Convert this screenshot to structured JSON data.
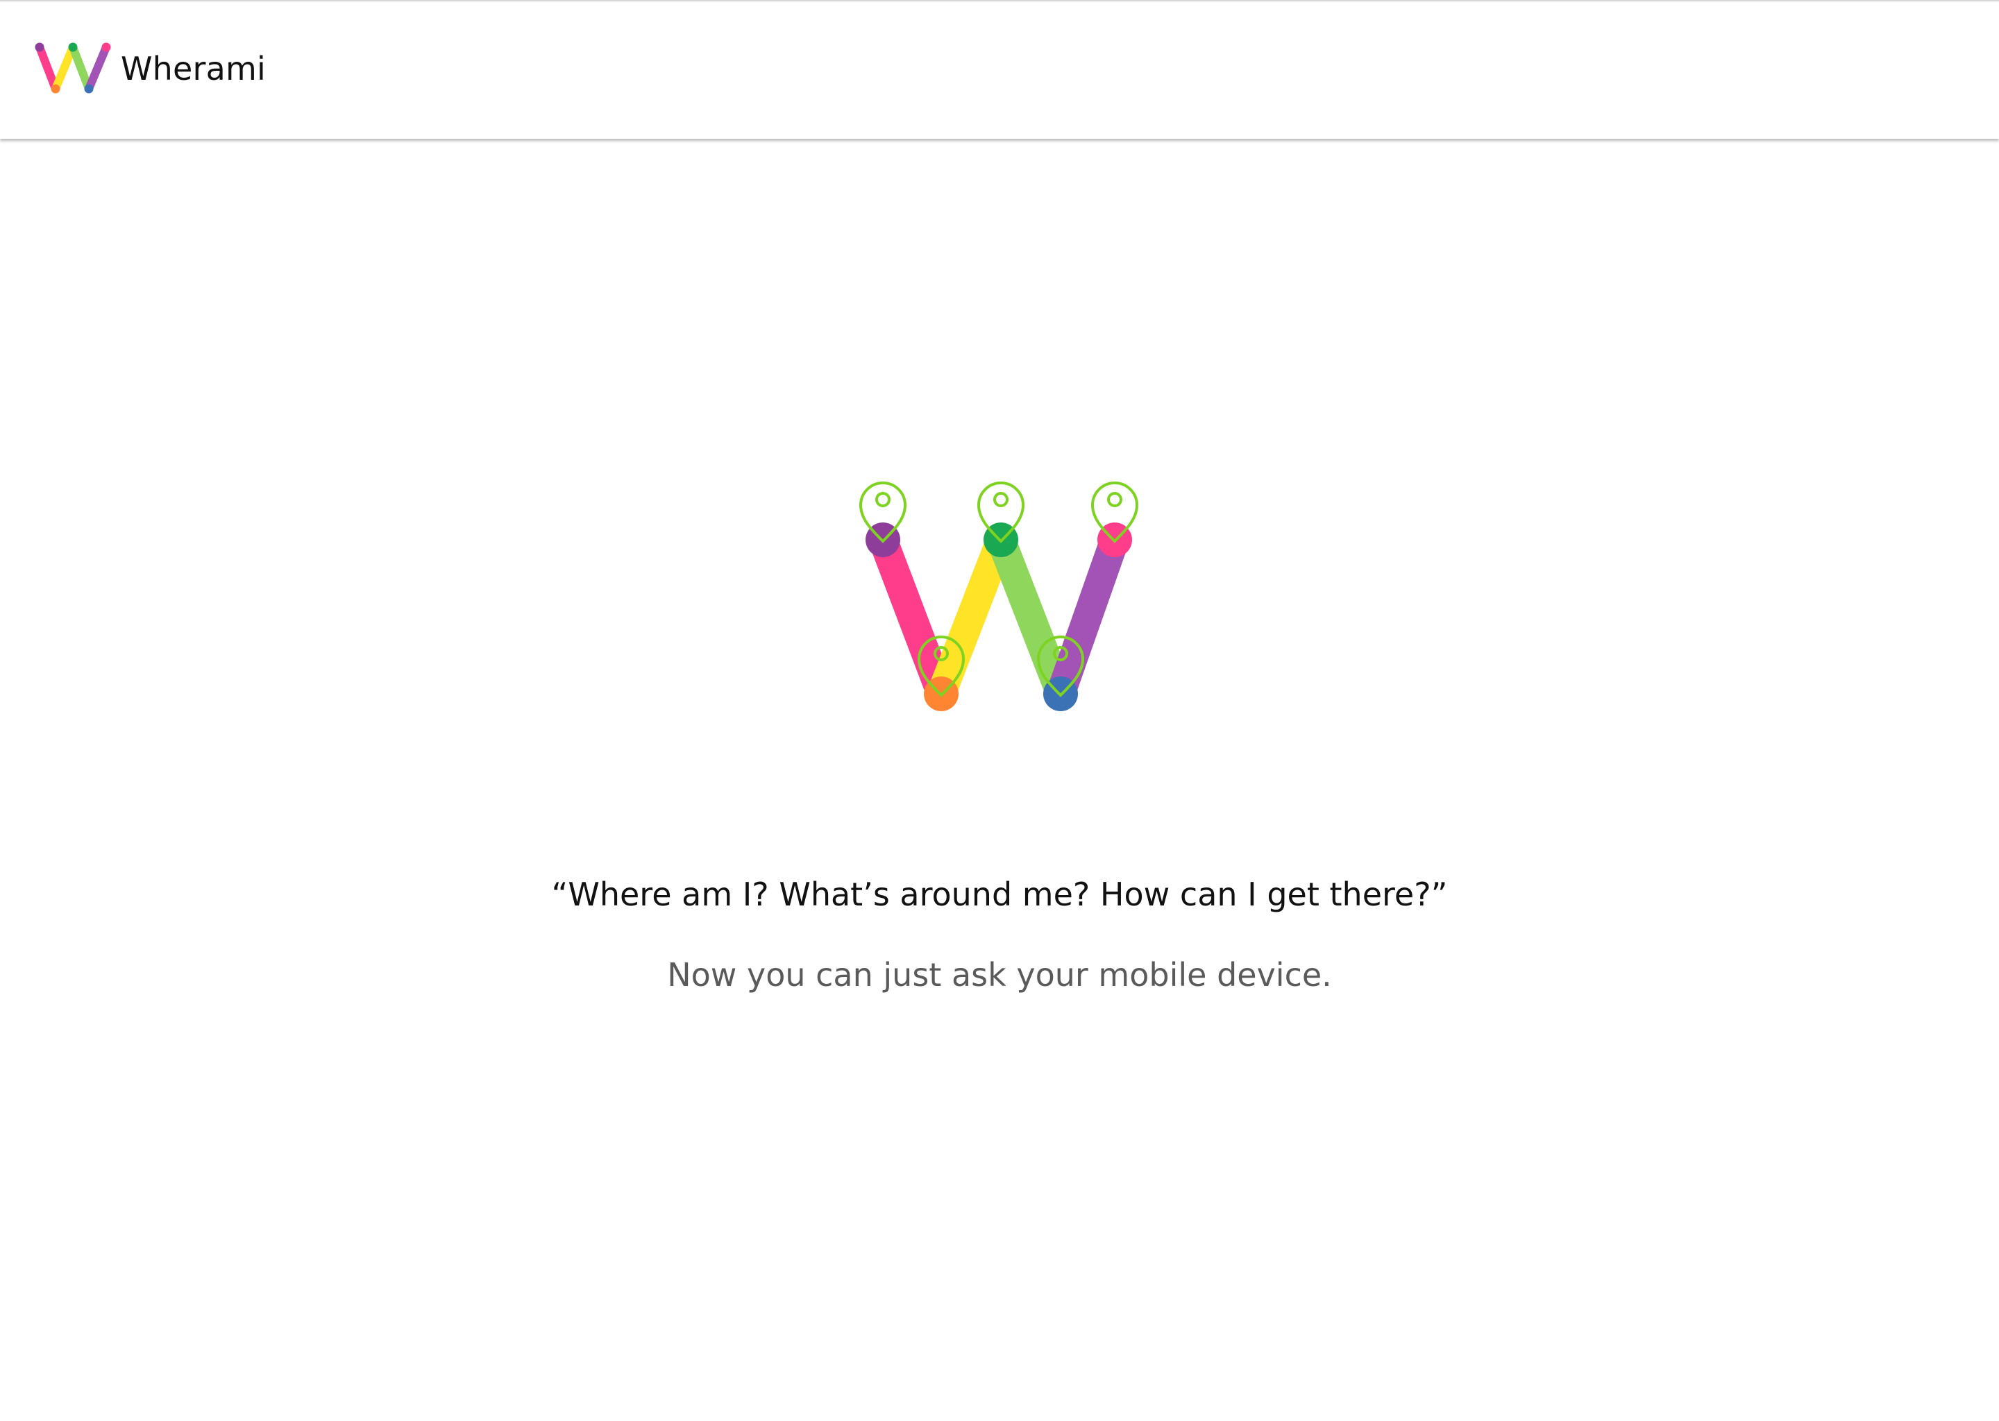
{
  "header": {
    "brand_name": "Wherami",
    "logo_icon": "wherami-w-logo-icon"
  },
  "hero": {
    "logo_icon": "wherami-w-location-pins-icon",
    "pin_icon": "map-pin-icon",
    "tagline": "“Where am I? What’s around me? How can I get there?”",
    "subtagline": "Now you can just ask your mobile device."
  },
  "colors": {
    "stroke_pink": "#ff3d8b",
    "stroke_yellow": "#ffe326",
    "stroke_green": "#8fd65c",
    "stroke_purple": "#a352b5",
    "dot_purple": "#8e3d9a",
    "dot_orange": "#ff8533",
    "dot_green": "#1ba852",
    "dot_blue": "#3b72b5",
    "dot_pink": "#ff3d8b",
    "pin_outline": "#7ed321",
    "text_primary": "#111111",
    "text_secondary": "#5a5a5a"
  }
}
